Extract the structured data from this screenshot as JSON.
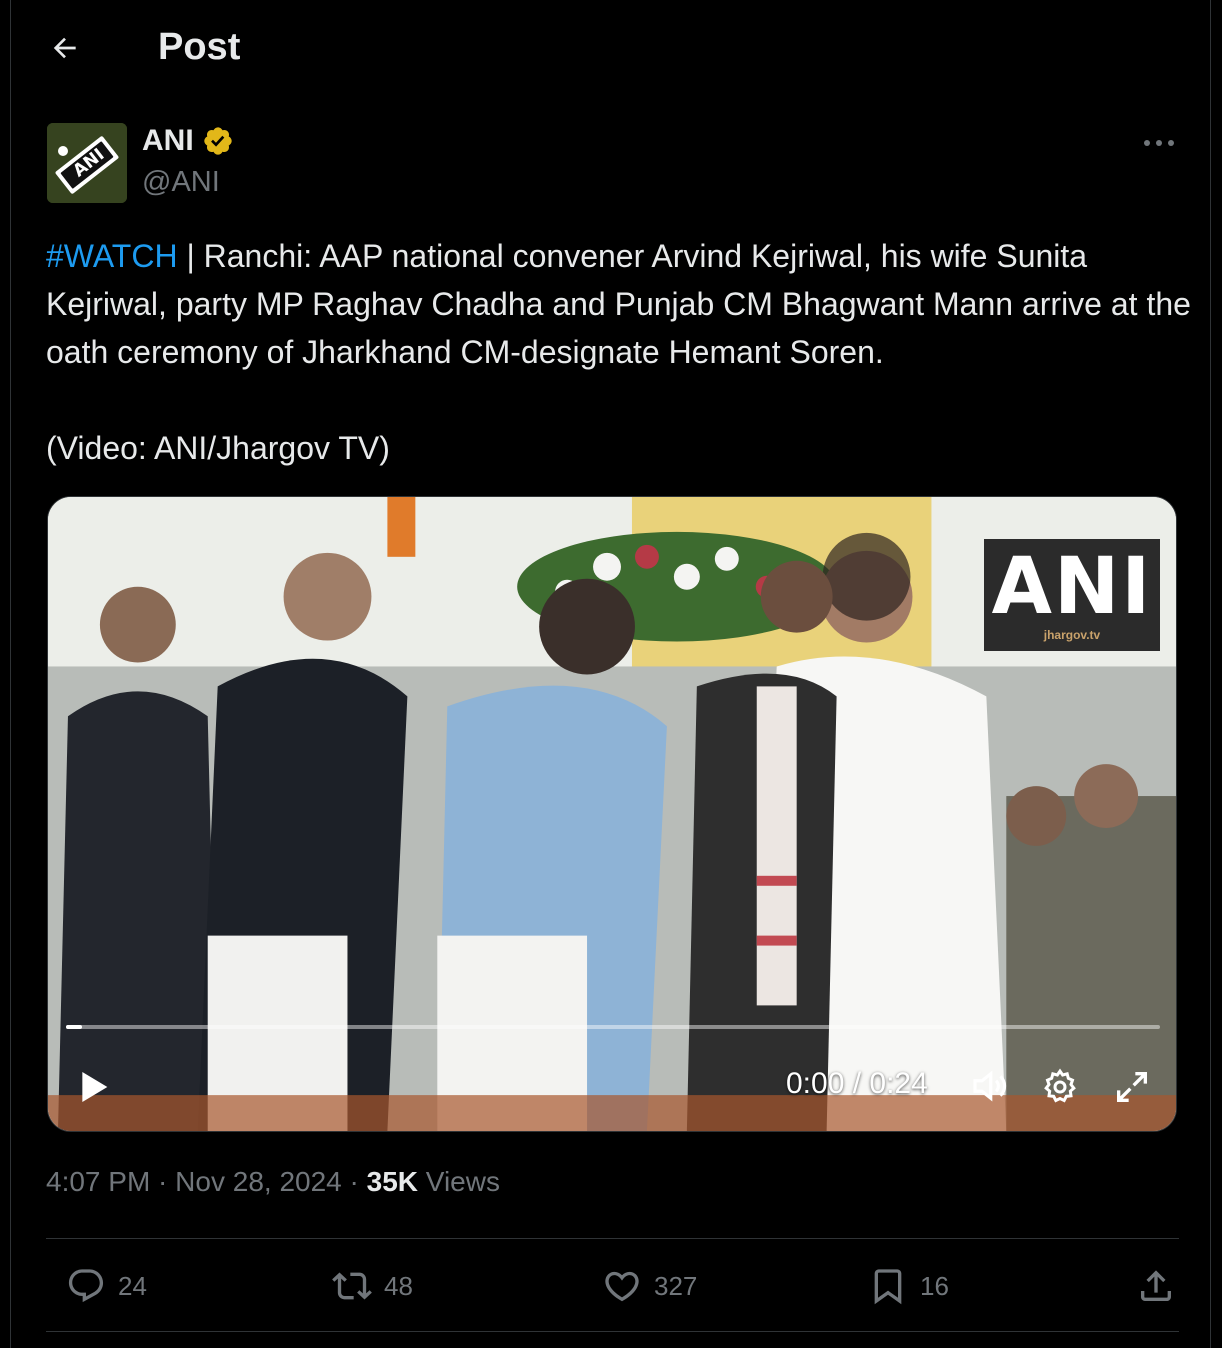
{
  "header": {
    "title": "Post"
  },
  "author": {
    "name": "ANI",
    "handle": "@ANI",
    "verified": true,
    "avatar_text": "ANI"
  },
  "tweet": {
    "hashtag": "#WATCH",
    "text_rest": " | Ranchi: AAP national convener Arvind Kejriwal, his wife Sunita Kejriwal, party MP Raghav Chadha and Punjab CM Bhagwant Mann arrive at the oath ceremony of Jharkhand CM-designate Hemant Soren.",
    "credit": "(Video: ANI/Jhargov TV)"
  },
  "video": {
    "watermark": "ANI",
    "watermark_sub": "jhargov.tv",
    "time_readout": "0:00 / 0:24",
    "progress": 0.015
  },
  "meta": {
    "time": "4:07 PM",
    "separator": " · ",
    "date": "Nov 28, 2024",
    "views_count": "35K",
    "views_label": " Views"
  },
  "actions": {
    "replies": "24",
    "reposts": "48",
    "likes": "327",
    "bookmarks": "16"
  },
  "colors": {
    "accent": "#1d9bf0",
    "muted": "#71767b",
    "text": "#e7e9ea",
    "border": "#2f3336",
    "verified": "#e2b719"
  }
}
